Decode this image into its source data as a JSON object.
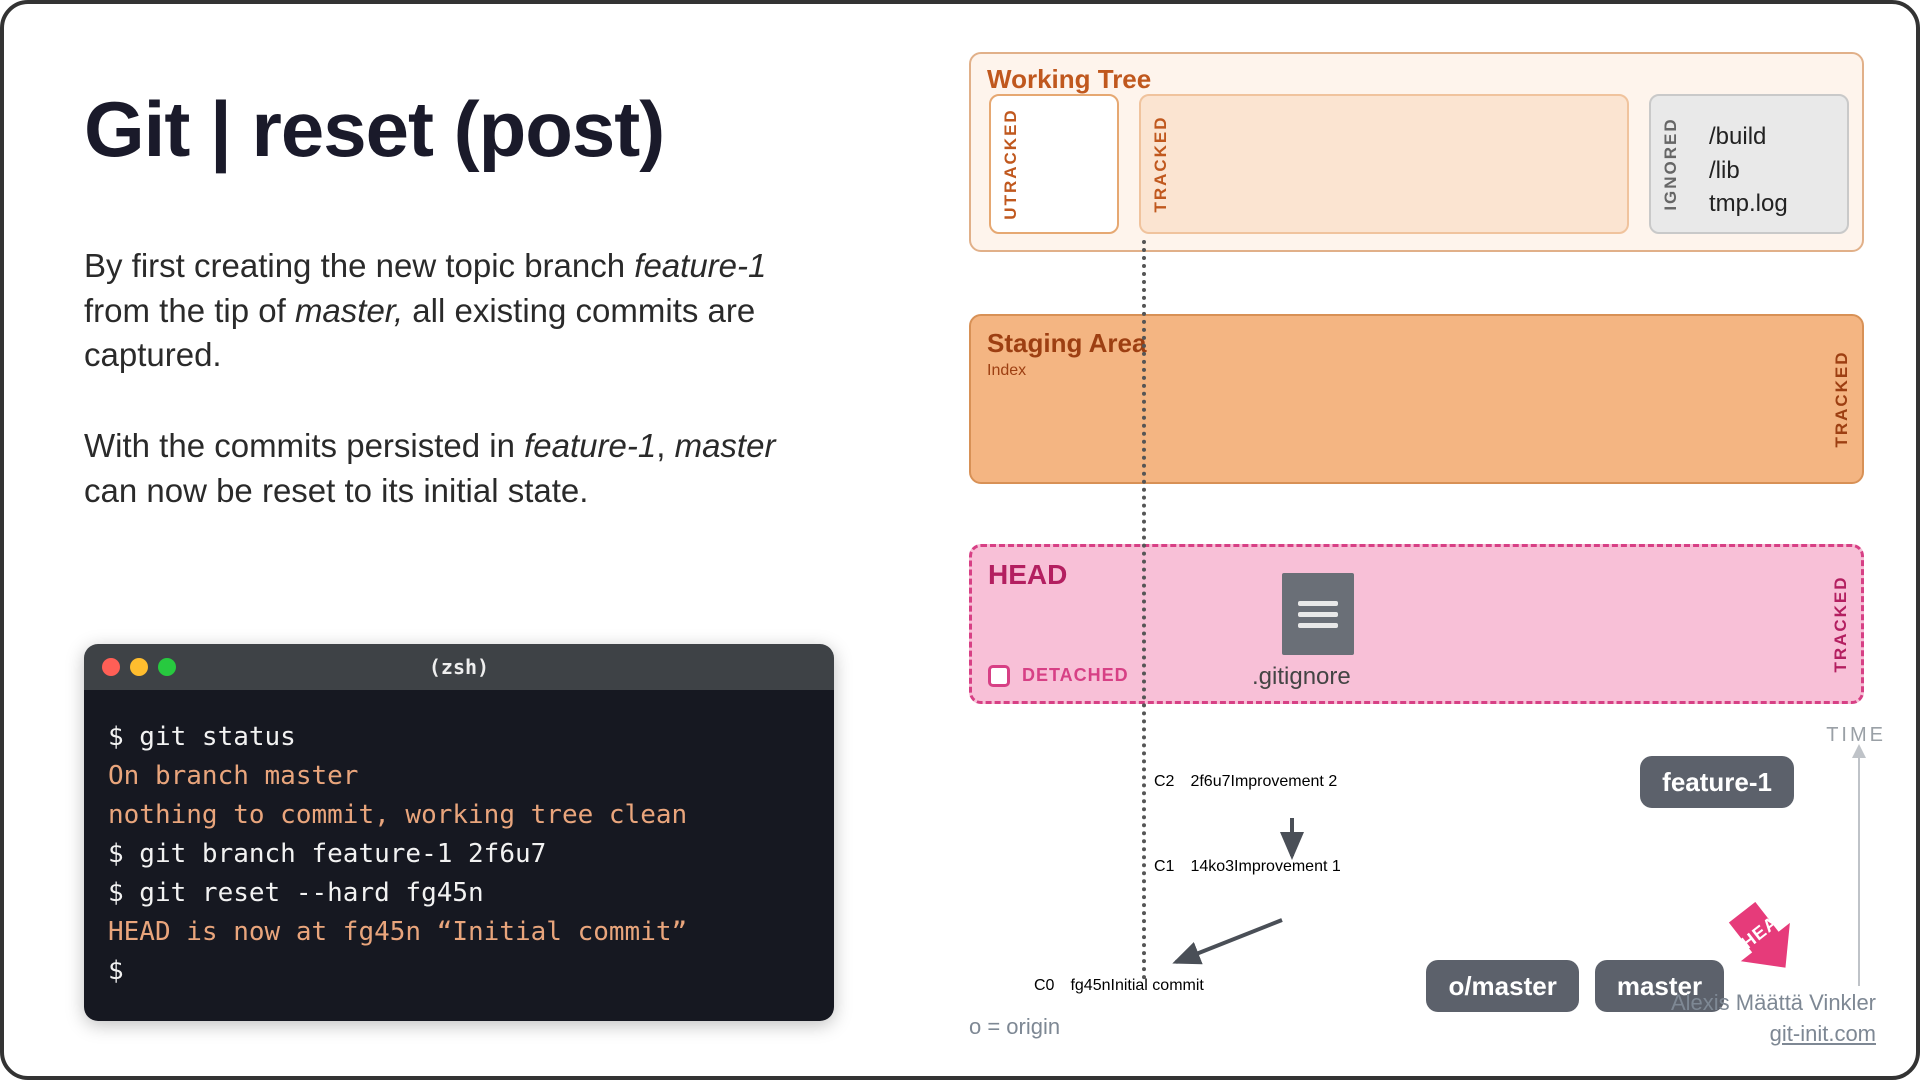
{
  "title": "Git | reset (post)",
  "para1_pre": "By first creating the new topic branch ",
  "para1_em1": "feature-1",
  "para1_mid": " from the tip of ",
  "para1_em2": "master,",
  "para1_post": " all existing commits are captured.",
  "para2_pre": "With the commits persisted in ",
  "para2_em1": "feature-1",
  "para2_mid": ", ",
  "para2_em2": "master",
  "para2_post": " can now be reset to its initial state.",
  "terminal": {
    "title": "(zsh)",
    "l1": "$ git status",
    "l2": "On branch master",
    "l3": "nothing to commit, working tree clean",
    "l4": "$ git branch feature-1 2f6u7",
    "l5": "$ git reset --hard fg45n",
    "l6": "HEAD is now at fg45n “Initial commit”",
    "l7": "$"
  },
  "working_tree": {
    "title": "Working Tree",
    "utracked": "UTRACKED",
    "tracked": "TRACKED",
    "ignored": "IGNORED",
    "ignored_files": "/build\n/lib\ntmp.log"
  },
  "staging": {
    "title": "Staging Area",
    "sub": "Index",
    "tracked": "TRACKED"
  },
  "head": {
    "title": "HEAD",
    "detached": "DETACHED",
    "tracked": "TRACKED",
    "file": ".gitignore"
  },
  "commits": {
    "c2": {
      "label": "C2",
      "hash": "2f6u7",
      "msg": "Improvement 2",
      "branch": "feature-1"
    },
    "c1": {
      "label": "C1",
      "hash": "14ko3",
      "msg": "Improvement 1"
    },
    "c0": {
      "label": "C0",
      "hash": "fg45n",
      "msg": "Initial commit",
      "branch1": "o/master",
      "branch2": "master"
    }
  },
  "time": "TIME",
  "origin": "o = origin",
  "credit": {
    "name": "Alexis Määttä Vinkler",
    "site": "git-init.com"
  },
  "head_arrow": "HEAD"
}
